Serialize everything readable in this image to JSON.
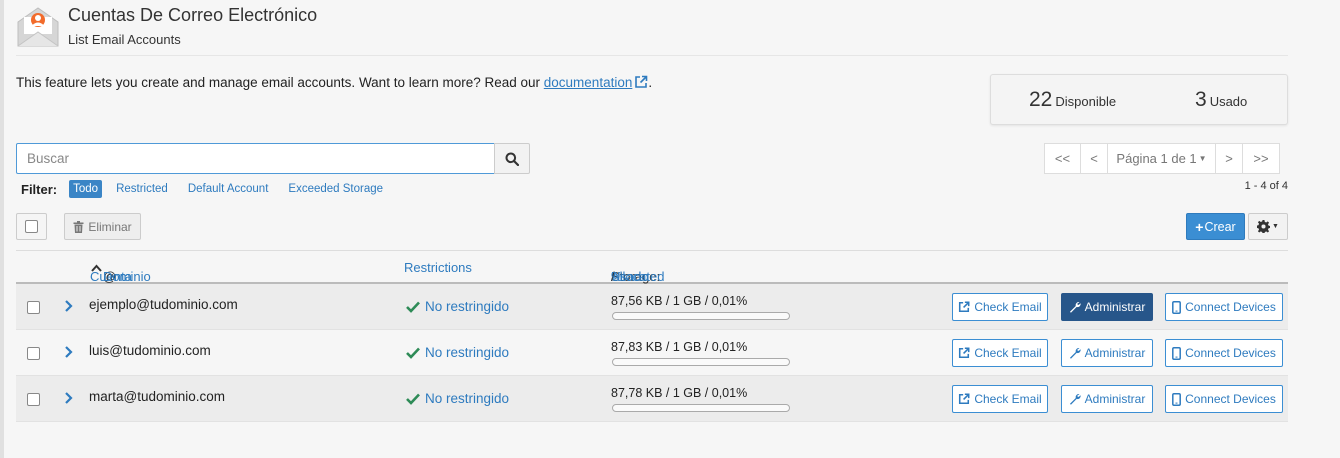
{
  "header": {
    "title": "Cuentas De Correo Electrónico",
    "subtitle": "List Email Accounts",
    "icon": "email-accounts-icon"
  },
  "intro": {
    "text": "This feature lets you create and manage email accounts. Want to learn more? Read our ",
    "link_label": "documentation",
    "suffix": "."
  },
  "stats": {
    "available_count": "22",
    "available_label": "Disponible",
    "used_count": "3",
    "used_label": "Usado"
  },
  "search": {
    "placeholder": "Buscar"
  },
  "pagination": {
    "first": "<<",
    "prev": "<",
    "page_label": "Página 1 de 1",
    "next": ">",
    "last": ">>",
    "count": "1 - 4 of 4"
  },
  "filter": {
    "label": "Filter:",
    "options": [
      "Todo",
      "Restricted",
      "Default Account",
      "Exceeded Storage"
    ],
    "active": "Todo"
  },
  "toolbar": {
    "delete_label": "Eliminar",
    "create_label": "Crear"
  },
  "table": {
    "headers": {
      "account": "Cuenta",
      "at": "@",
      "domain": "Dominio",
      "restrictions": "Restrictions",
      "storage": "Storage:",
      "used": "Usado",
      "sep1": "/",
      "allocated": "Allocated",
      "sep2": "/",
      "percent": "%"
    },
    "rows": [
      {
        "email": "ejemplo@tudominio.com",
        "restriction": "No restringido",
        "storage": "87,56 KB / 1 GB / 0,01%",
        "usage_fraction": 0.0001,
        "check_label": "Check Email",
        "admin_label": "Administrar",
        "connect_label": "Connect Devices"
      },
      {
        "email": "luis@tudominio.com",
        "restriction": "No restringido",
        "storage": "87,83 KB / 1 GB / 0,01%",
        "usage_fraction": 0.0001,
        "check_label": "Check Email",
        "admin_label": "Administrar",
        "connect_label": "Connect Devices"
      },
      {
        "email": "marta@tudominio.com",
        "restriction": "No restringido",
        "storage": "87,78 KB / 1 GB / 0,01%",
        "usage_fraction": 0.0001,
        "check_label": "Check Email",
        "admin_label": "Administrar",
        "connect_label": "Connect Devices"
      }
    ]
  },
  "colors": {
    "accent": "#3b8ed3",
    "link": "#2e7bbf",
    "success": "#2e8b57",
    "admin_active": "#27568a",
    "brand_orange": "#f26b2b"
  }
}
